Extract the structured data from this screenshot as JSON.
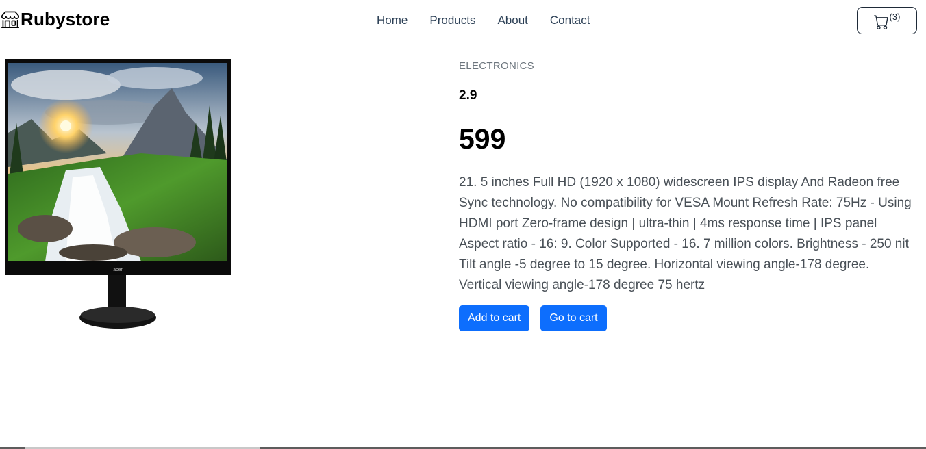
{
  "header": {
    "brand": {
      "name": "Rubystore",
      "icon": "store-icon"
    },
    "nav": [
      {
        "label": "Home"
      },
      {
        "label": "Products"
      },
      {
        "label": "About"
      },
      {
        "label": "Contact"
      }
    ],
    "cart": {
      "icon": "cart-icon",
      "count": "(3)"
    }
  },
  "product": {
    "category": "ELECTRONICS",
    "rating": "2.9",
    "price": "599",
    "description": "21. 5 inches Full HD (1920 x 1080) widescreen IPS display And Radeon free Sync technology. No compatibility for VESA Mount Refresh Rate: 75Hz - Using HDMI port Zero-frame design | ultra-thin | 4ms response time | IPS panel Aspect ratio - 16: 9. Color Supported - 16. 7 million colors. Brightness - 250 nit Tilt angle -5 degree to 15 degree. Horizontal viewing angle-178 degree. Vertical viewing angle-178 degree 75 hertz",
    "image": {
      "icon": "monitor-image",
      "brand_mark": "acer"
    },
    "actions": {
      "add_to_cart": "Add to cart",
      "go_to_cart": "Go to cart"
    }
  },
  "colors": {
    "primary": "#0d6efd",
    "nav_text": "#2b3f55",
    "muted": "#6c757d"
  }
}
